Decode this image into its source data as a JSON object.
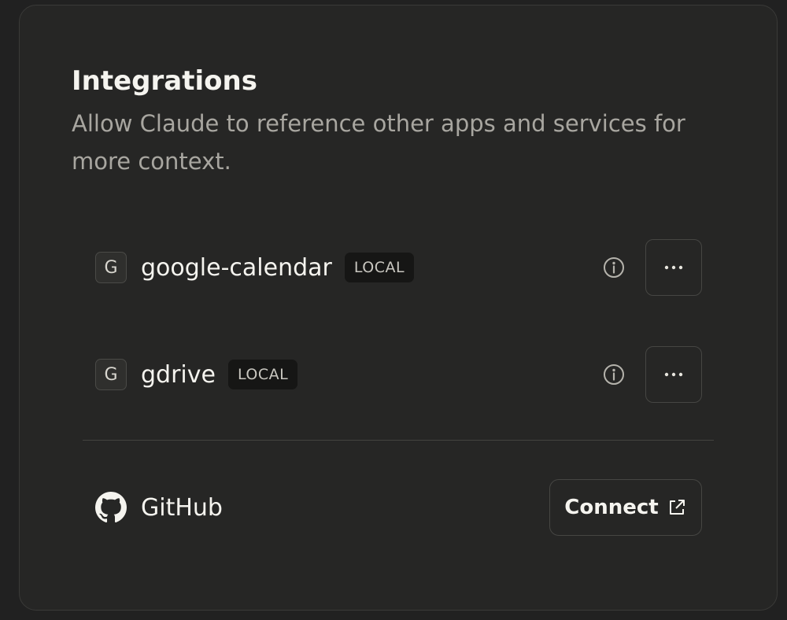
{
  "section": {
    "title": "Integrations",
    "subtitle": "Allow Claude to reference other apps and services for more context."
  },
  "integrations": [
    {
      "letter": "G",
      "name": "google-calendar",
      "badge": "LOCAL",
      "info_icon": "info-icon",
      "more_icon": "ellipsis-icon"
    },
    {
      "letter": "G",
      "name": "gdrive",
      "badge": "LOCAL",
      "info_icon": "info-icon",
      "more_icon": "ellipsis-icon"
    }
  ],
  "available": {
    "icon": "github-icon",
    "name": "GitHub",
    "button_label": "Connect",
    "button_icon": "external-link-icon"
  },
  "colors": {
    "background": "#262625",
    "text_primary": "#f5f4ef",
    "text_secondary": "#a8a6a0",
    "badge_bg": "#161615"
  }
}
